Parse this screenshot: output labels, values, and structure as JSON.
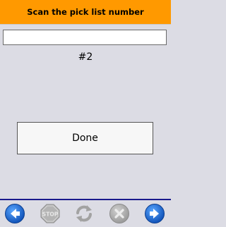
{
  "header": {
    "title": "Scan the pick list number"
  },
  "scan": {
    "value": "",
    "counter": "#2"
  },
  "actions": {
    "done_label": "Done"
  },
  "toolbar": {
    "buttons": [
      {
        "name": "back",
        "icon": "back-arrow-icon",
        "enabled": true,
        "color": "#1e6fd9"
      },
      {
        "name": "stop",
        "icon": "stop-sign-icon",
        "enabled": false,
        "color": "#a8a8a8"
      },
      {
        "name": "refresh",
        "icon": "refresh-icon",
        "enabled": false,
        "color": "#a8a8a8"
      },
      {
        "name": "cancel",
        "icon": "cancel-x-icon",
        "enabled": false,
        "color": "#a8a8a8"
      },
      {
        "name": "forward",
        "icon": "forward-arrow-icon",
        "enabled": true,
        "color": "#1e6fd9"
      }
    ]
  },
  "colors": {
    "header_bg": "#ff9900",
    "page_bg": "#dcdce4",
    "toolbar_line": "#1a1a8c"
  }
}
